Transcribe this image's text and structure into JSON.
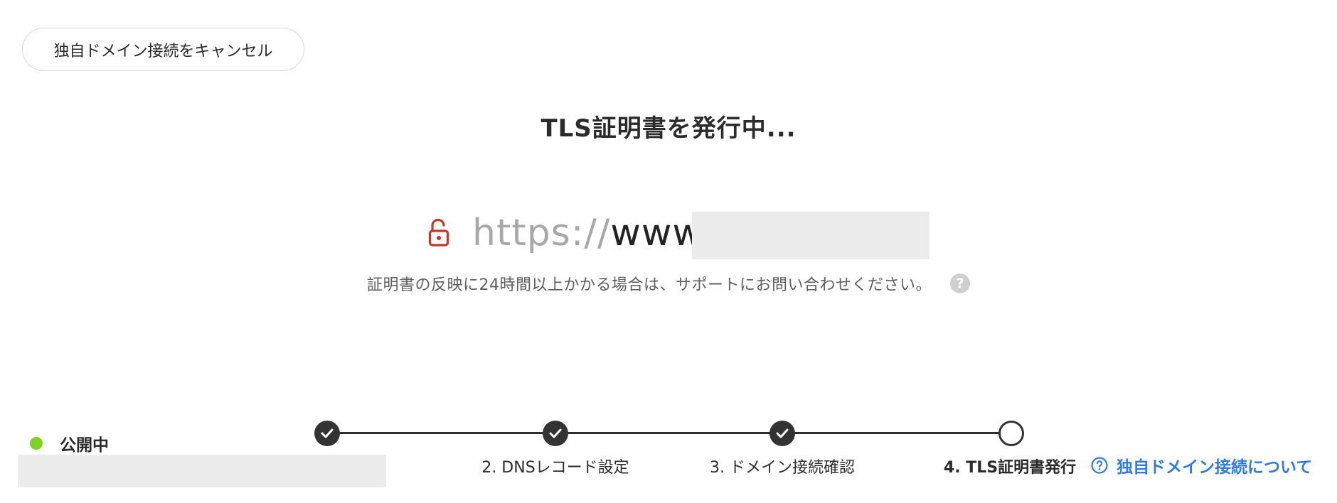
{
  "header": {
    "cancel_label": "独自ドメイン接続をキャンセル"
  },
  "main": {
    "title": "TLS証明書を発行中...",
    "url_scheme": "https://",
    "url_host_visible": "www.",
    "lock_icon": "unlocked-padlock-icon",
    "lock_color": "#c0392b",
    "note": "証明書の反映に24時間以上かかる場合は、サポートにお問い合わせください。",
    "help_icon": "question-circle-icon"
  },
  "status": {
    "label": "公開中",
    "dot_color": "#7ed321"
  },
  "stepper": {
    "steps": [
      {
        "label": "",
        "state": "done"
      },
      {
        "label": "2. DNSレコード設定",
        "state": "done"
      },
      {
        "label": "3. ドメイン接続確認",
        "state": "done"
      },
      {
        "label": "4. TLS証明書発行",
        "state": "current"
      }
    ]
  },
  "help_link": {
    "label": "独自ドメイン接続について",
    "icon": "question-circle-icon",
    "color": "#2f7be0"
  }
}
